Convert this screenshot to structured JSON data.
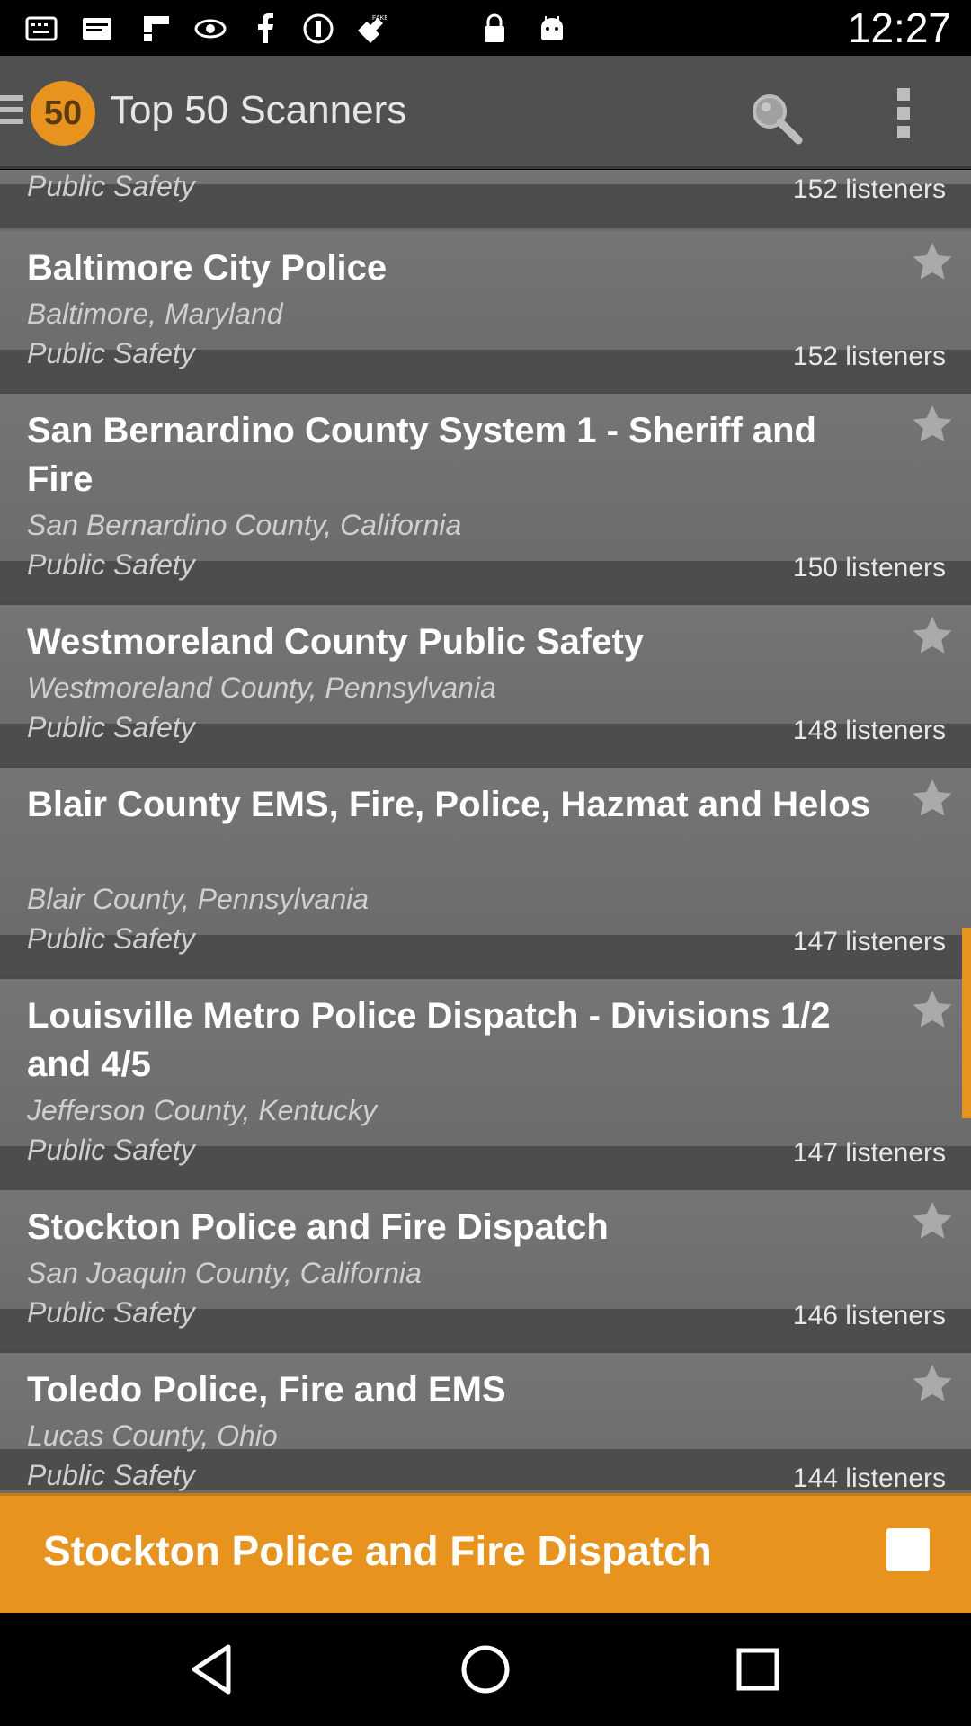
{
  "status_bar": {
    "time": "12:27",
    "icons": [
      "keyboard-icon",
      "email-icon",
      "flipboard-icon",
      "vpn-eye-icon",
      "facebook-icon",
      "circle-p-icon",
      "fake-gps-icon",
      "lock-icon",
      "android-icon"
    ]
  },
  "app_bar": {
    "logo_text": "50",
    "title": "Top 50 Scanners"
  },
  "list": {
    "partial_top": {
      "genre": "Public Safety",
      "listeners": "152 listeners"
    },
    "items": [
      {
        "name": "Baltimore City Police",
        "location": "Baltimore, Maryland",
        "genre": "Public Safety",
        "listeners": "152 listeners"
      },
      {
        "name": "San Bernardino County System 1 - Sheriff and Fire",
        "location": "San Bernardino County, California",
        "genre": "Public Safety",
        "listeners": "150 listeners"
      },
      {
        "name": "Westmoreland County Public Safety",
        "location": "Westmoreland County, Pennsylvania",
        "genre": "Public Safety",
        "listeners": "148 listeners"
      },
      {
        "name": "Blair County EMS, Fire, Police, Hazmat and Helos",
        "location": "Blair County, Pennsylvania",
        "genre": "Public Safety",
        "listeners": "147 listeners"
      },
      {
        "name": "Louisville Metro Police Dispatch - Divisions 1/2 and 4/5",
        "location": "Jefferson County, Kentucky",
        "genre": "Public Safety",
        "listeners": "147 listeners"
      },
      {
        "name": "Stockton Police and Fire Dispatch",
        "location": "San Joaquin County, California",
        "genre": "Public Safety",
        "listeners": "146 listeners"
      },
      {
        "name": "Toledo Police, Fire and EMS",
        "location": "Lucas County, Ohio",
        "genre": "Public Safety",
        "listeners": "144 listeners"
      }
    ]
  },
  "now_playing": {
    "title": "Stockton Police and Fire Dispatch"
  },
  "colors": {
    "accent": "#e8931e",
    "app_bar": "#505050",
    "row": "#707070",
    "band": "#4d4d4d"
  }
}
